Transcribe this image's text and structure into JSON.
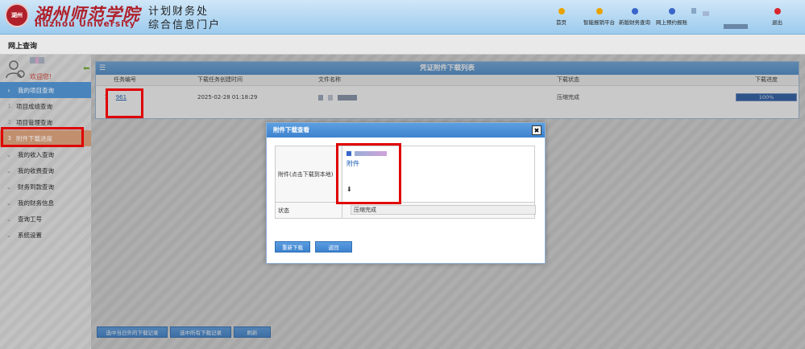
{
  "header": {
    "logo_seal_text": "湖州\n师院",
    "university_cn": "湖州师范学院",
    "university_en": "Huzhou University",
    "dept_line1": "计划财务处",
    "dept_line2": "综合信息门户",
    "nav": [
      {
        "label": "首页",
        "color": "#e8a300",
        "icon": "home-icon"
      },
      {
        "label": "智能报销平台",
        "color": "#e8a300",
        "icon": "reimburse-icon"
      },
      {
        "label": "新版财务查询",
        "color": "#3a66c9",
        "icon": "finance-query-icon"
      },
      {
        "label": "网上预约报账",
        "color": "#3a66c9",
        "icon": "booking-icon"
      },
      {
        "label": "退出",
        "color": "#d9262b",
        "icon": "logout-icon"
      }
    ]
  },
  "subbar": {
    "title": "网上查询"
  },
  "sidebar": {
    "welcome": "欢迎您!",
    "items": [
      {
        "label": "我的项目查询",
        "kind": "group-active"
      },
      {
        "label": "项目成绩查询",
        "kind": "sub",
        "num": "1"
      },
      {
        "label": "项目管理查询",
        "kind": "sub",
        "num": "2"
      },
      {
        "label": "附件下载进度",
        "kind": "active",
        "num": "3"
      },
      {
        "label": "我的收入查询",
        "kind": "group"
      },
      {
        "label": "我的收费查询",
        "kind": "group"
      },
      {
        "label": "财务到款查询",
        "kind": "group"
      },
      {
        "label": "我的财务信息",
        "kind": "group"
      },
      {
        "label": "查询工号",
        "kind": "group"
      },
      {
        "label": "系统设置",
        "kind": "group"
      }
    ]
  },
  "main": {
    "panel_title": "凭证附件下载列表",
    "columns": [
      "任务编号",
      "下载任务创建时间",
      "文件名称",
      "下载状态",
      "下载进度"
    ],
    "rows": [
      {
        "task_id": "961",
        "created": "2025-02-28 01:18:29",
        "file_name": "",
        "status": "压缩完成",
        "progress_label": "100%",
        "progress_fraction": 1.0
      }
    ],
    "bottom_buttons": [
      "选中当日外的下载记录",
      "选中所有下载记录",
      "刷新"
    ]
  },
  "modal": {
    "title": "附件下载查看",
    "close": "✖",
    "attachment_label": "附件(点击下载到本地)",
    "attachment_link": "附件",
    "status_label": "状态",
    "status_value": "压缩完成",
    "retry_button": "重新下载",
    "back_button": "返回"
  },
  "colors": {
    "accent": "#4d8fce",
    "active_menu": "#d49b76",
    "highlight": "#e00000",
    "brand": "#b0202a"
  }
}
